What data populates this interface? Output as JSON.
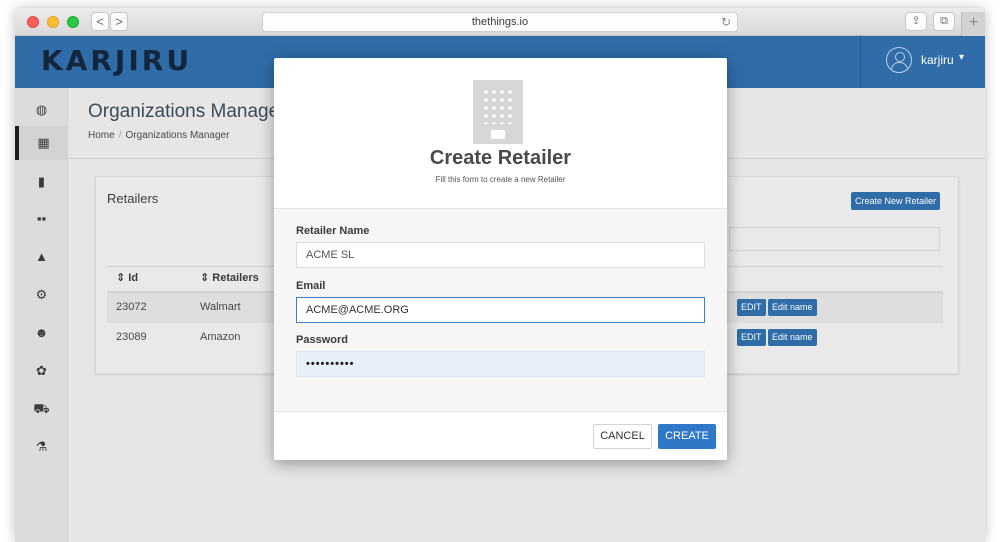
{
  "browser": {
    "url": "thethings.io",
    "back_glyph": "<",
    "forward_glyph": ">",
    "reload_glyph": "↻",
    "share_glyph": "⇪",
    "tabs_glyph": "⧉",
    "newtab_glyph": "+"
  },
  "app": {
    "logo": "KARJIRU",
    "user": {
      "name": "karjiru",
      "caret": "▾"
    },
    "brand_color": "#2f6ca8"
  },
  "sidebar": {
    "items": [
      {
        "icon": "dashboard-icon",
        "glyph": "◍"
      },
      {
        "icon": "building-icon",
        "glyph": "▦",
        "active": true
      },
      {
        "icon": "device-icon",
        "glyph": "▮"
      },
      {
        "icon": "grid-icon",
        "glyph": "▪▪"
      },
      {
        "icon": "bell-icon",
        "glyph": "▲"
      },
      {
        "icon": "gears-icon",
        "glyph": "⚙"
      },
      {
        "icon": "users-icon",
        "glyph": "☻"
      },
      {
        "icon": "paw-icon",
        "glyph": "✿"
      },
      {
        "icon": "cart-icon",
        "glyph": "⛟"
      },
      {
        "icon": "flask-icon",
        "glyph": "⚗"
      }
    ]
  },
  "page": {
    "title": "Organizations Manager",
    "breadcrumb": [
      "Home",
      "Organizations Manager"
    ],
    "breadcrumb_sep": "/"
  },
  "panel": {
    "title": "Retailers",
    "create_new_label": "Create New Retailer",
    "columns": [
      {
        "label": "Id",
        "sort_glyph": "⇕"
      },
      {
        "label": "Retailers",
        "sort_glyph": "⇕"
      }
    ],
    "rows": [
      {
        "id": "23072",
        "name": "Walmart",
        "edit_label": "EDIT",
        "edit_name_label": "Edit name"
      },
      {
        "id": "23089",
        "name": "Amazon",
        "edit_label": "EDIT",
        "edit_name_label": "Edit name"
      }
    ]
  },
  "modal": {
    "title": "Create Retailer",
    "subtitle": "Fill this form to create a new Retailer",
    "fields": {
      "retailer_name": {
        "label": "Retailer Name",
        "value": "ACME SL"
      },
      "email": {
        "label": "Email",
        "value": "ACME@ACME.ORG"
      },
      "password": {
        "label": "Password",
        "value": "••••••••••"
      }
    },
    "cancel_label": "CANCEL",
    "create_label": "CREATE"
  }
}
